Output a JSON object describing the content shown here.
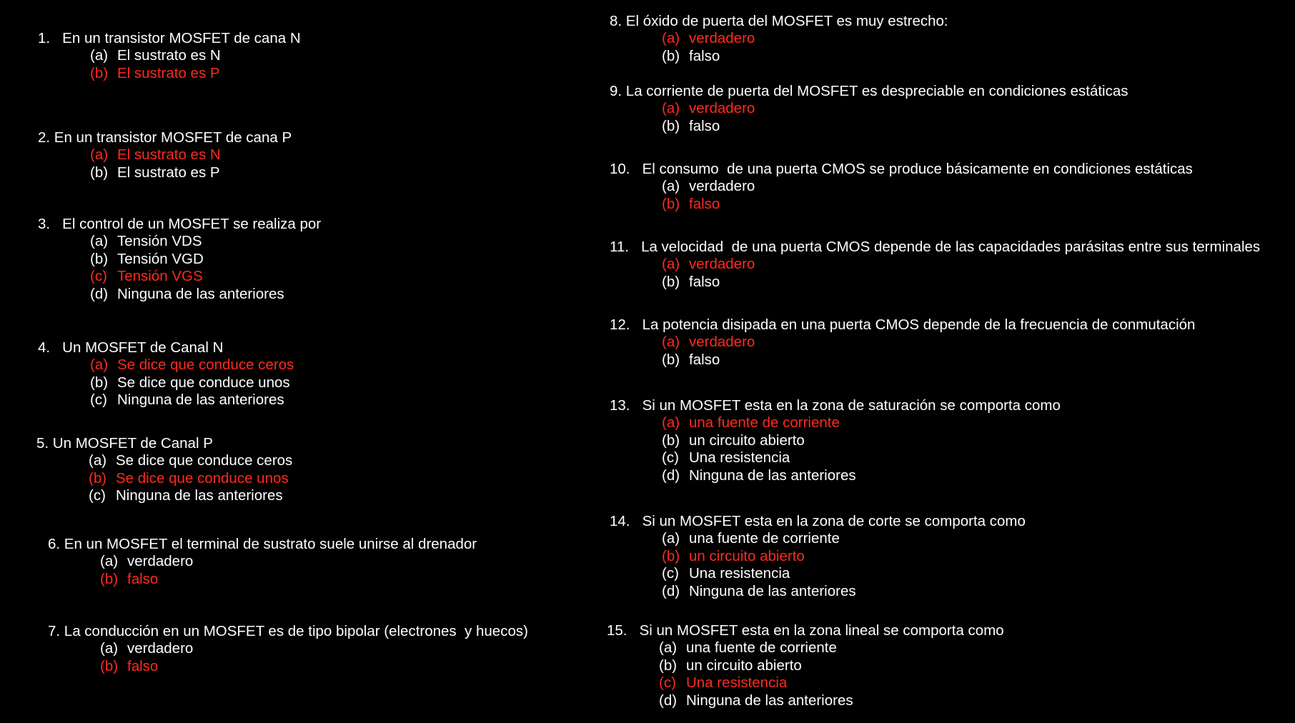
{
  "colors": {
    "background": "#000000",
    "text": "#ffffff",
    "correct_answer": "#ff2a1f"
  },
  "questions": [
    {
      "text": "1.   En un transistor MOSFET de cana N",
      "options": [
        {
          "letter": "(a)",
          "text": "El sustrato es N",
          "correct": false
        },
        {
          "letter": "(b)",
          "text": "El sustrato es P",
          "correct": true
        }
      ]
    },
    {
      "text": "2. En un transistor MOSFET de cana P",
      "options": [
        {
          "letter": "(a)",
          "text": "El sustrato es N",
          "correct": true
        },
        {
          "letter": "(b)",
          "text": "El sustrato es P",
          "correct": false
        }
      ]
    },
    {
      "text": "3.   El control de un MOSFET se realiza por",
      "options": [
        {
          "letter": "(a)",
          "text": "Tensión VDS",
          "correct": false
        },
        {
          "letter": "(b)",
          "text": "Tensión VGD",
          "correct": false
        },
        {
          "letter": "(c)",
          "text": "Tensión VGS",
          "correct": true
        },
        {
          "letter": "(d)",
          "text": "Ninguna de las anteriores",
          "correct": false
        }
      ]
    },
    {
      "text": "4.   Un MOSFET de Canal N",
      "options": [
        {
          "letter": "(a)",
          "text": "Se dice que conduce ceros",
          "correct": true
        },
        {
          "letter": "(b)",
          "text": "Se dice que conduce unos",
          "correct": false
        },
        {
          "letter": "(c)",
          "text": "Ninguna de las anteriores",
          "correct": false
        }
      ]
    },
    {
      "text": "5. Un MOSFET de Canal P",
      "options": [
        {
          "letter": "(a)",
          "text": "Se dice que conduce ceros",
          "correct": false
        },
        {
          "letter": "(b)",
          "text": "Se dice que conduce unos",
          "correct": true
        },
        {
          "letter": "(c)",
          "text": "Ninguna de las anteriores",
          "correct": false
        }
      ]
    },
    {
      "text": "6. En un MOSFET el terminal de sustrato suele unirse al drenador",
      "options": [
        {
          "letter": "(a)",
          "text": "verdadero",
          "correct": false
        },
        {
          "letter": "(b)",
          "text": "falso",
          "correct": true
        }
      ]
    },
    {
      "text": "7. La conducción en un MOSFET es de tipo bipolar (electrones  y huecos)",
      "options": [
        {
          "letter": "(a)",
          "text": "verdadero",
          "correct": false
        },
        {
          "letter": "(b)",
          "text": "falso",
          "correct": true
        }
      ]
    },
    {
      "text": "8. El óxido de puerta del MOSFET es muy estrecho:",
      "options": [
        {
          "letter": "(a)",
          "text": "verdadero",
          "correct": true
        },
        {
          "letter": "(b)",
          "text": "falso",
          "correct": false
        }
      ]
    },
    {
      "text": "9. La corriente de puerta del MOSFET es despreciable en condiciones estáticas",
      "options": [
        {
          "letter": "(a)",
          "text": "verdadero",
          "correct": true
        },
        {
          "letter": "(b)",
          "text": "falso",
          "correct": false
        }
      ]
    },
    {
      "text": "10.   El consumo  de una puerta CMOS se produce básicamente en condiciones estáticas",
      "options": [
        {
          "letter": "(a)",
          "text": "verdadero",
          "correct": false
        },
        {
          "letter": "(b)",
          "text": "falso",
          "correct": true
        }
      ]
    },
    {
      "text": "11.   La velocidad  de una puerta CMOS depende de las capacidades parásitas entre sus terminales",
      "options": [
        {
          "letter": "(a)",
          "text": "verdadero",
          "correct": true
        },
        {
          "letter": "(b)",
          "text": "falso",
          "correct": false
        }
      ]
    },
    {
      "text": "12.   La potencia disipada en una puerta CMOS depende de la frecuencia de conmutación",
      "options": [
        {
          "letter": "(a)",
          "text": "verdadero",
          "correct": true
        },
        {
          "letter": "(b)",
          "text": "falso",
          "correct": false
        }
      ]
    },
    {
      "text": "13.   Si un MOSFET esta en la zona de saturación se comporta como",
      "options": [
        {
          "letter": "(a)",
          "text": "una fuente de corriente",
          "correct": true
        },
        {
          "letter": "(b)",
          "text": "un circuito abierto",
          "correct": false
        },
        {
          "letter": "(c)",
          "text": "Una resistencia",
          "correct": false
        },
        {
          "letter": "(d)",
          "text": "Ninguna de las anteriores",
          "correct": false
        }
      ]
    },
    {
      "text": "14.   Si un MOSFET esta en la zona de corte se comporta como",
      "options": [
        {
          "letter": "(a)",
          "text": "una fuente de corriente",
          "correct": false
        },
        {
          "letter": "(b)",
          "text": "un circuito abierto",
          "correct": true
        },
        {
          "letter": "(c)",
          "text": "Una resistencia",
          "correct": false
        },
        {
          "letter": "(d)",
          "text": "Ninguna de las anteriores",
          "correct": false
        }
      ]
    },
    {
      "text": "15.   Si un MOSFET esta en la zona lineal se comporta como",
      "options": [
        {
          "letter": "(a)",
          "text": "una fuente de corriente",
          "correct": false
        },
        {
          "letter": "(b)",
          "text": "un circuito abierto",
          "correct": false
        },
        {
          "letter": "(c)",
          "text": "Una resistencia",
          "correct": true
        },
        {
          "letter": "(d)",
          "text": "Ninguna de las anteriores",
          "correct": false
        }
      ]
    }
  ]
}
